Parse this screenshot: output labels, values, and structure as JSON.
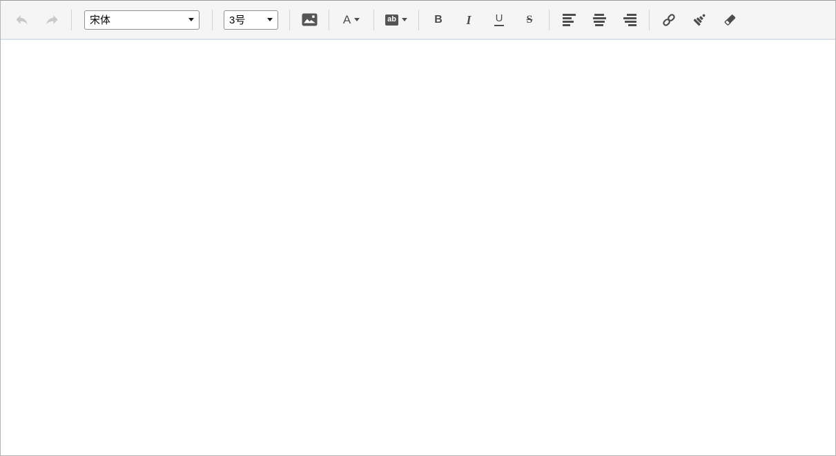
{
  "toolbar": {
    "undo": {
      "icon": "undo-icon",
      "enabled": false
    },
    "redo": {
      "icon": "redo-icon",
      "enabled": false
    },
    "font_family_select": {
      "value": "宋体"
    },
    "font_size_select": {
      "value": "3号"
    },
    "labels": {
      "font_color": "A",
      "background_color": "ab",
      "bold": "B",
      "italic": "I",
      "underline": "U",
      "strikethrough": "S"
    },
    "icons": [
      "undo-icon",
      "redo-icon",
      "image-icon",
      "dropdown-caret-icon",
      "align-left-icon",
      "align-center-icon",
      "align-right-icon",
      "link-icon",
      "brush-icon",
      "eraser-icon"
    ]
  },
  "content": {
    "text": ""
  },
  "colors": {
    "toolbar_bg": "#f5f5f5",
    "icon": "#4d4d4d",
    "icon_disabled": "#c9c9c9",
    "separator": "#d2d2d2",
    "toolbar_bottom_border": "#dbe2e9",
    "outer_border": "#b3b3b3",
    "select_border": "#8f8f8f",
    "badge_bg": "#555555"
  }
}
